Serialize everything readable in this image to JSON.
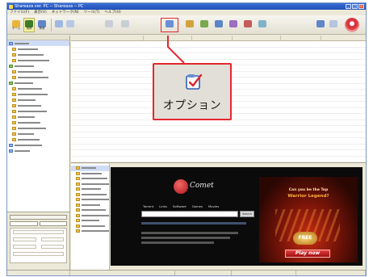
{
  "window": {
    "title": "Shareaza ver. PC -- Shareaza -- PC",
    "colors": {
      "accent": "#e52730",
      "titlebar": "#2a5fcc",
      "ad_background": "#0b0b0b"
    }
  },
  "menu": [
    "ファイル(F)",
    "表示(V)",
    "ネットワーク(N)",
    "ツール(T)",
    "ヘルプ(H)"
  ],
  "toolbar": {
    "buttons": [
      {
        "label": "ホーム",
        "icon": "home-icon"
      },
      {
        "label": "接続",
        "icon": "connect-icon"
      },
      {
        "label": "検索",
        "icon": "search-icon"
      },
      {
        "label": "",
        "icon": "nav-icon"
      },
      {
        "label": "",
        "icon": "nav-icon"
      },
      {
        "label": "",
        "icon": "nav-icon"
      },
      {
        "label": "",
        "icon": "options-icon"
      },
      {
        "label": "",
        "icon": "media-icon"
      },
      {
        "label": "",
        "icon": "media-icon"
      },
      {
        "label": "",
        "icon": "media-icon"
      },
      {
        "label": "",
        "icon": "media-icon"
      },
      {
        "label": "",
        "icon": "media-icon"
      }
    ]
  },
  "callout": {
    "label": "オプション",
    "icon": "options-checkmark-icon"
  },
  "sidebar": {
    "header": "",
    "items": [
      {
        "label": "",
        "kind": "blue"
      },
      {
        "label": "",
        "kind": "folder"
      },
      {
        "label": "",
        "kind": "folder"
      },
      {
        "label": "",
        "kind": "folder"
      },
      {
        "label": "",
        "kind": "green"
      },
      {
        "label": "",
        "kind": "folder"
      },
      {
        "label": "",
        "kind": "folder"
      },
      {
        "label": "",
        "kind": "green"
      },
      {
        "label": "",
        "kind": "folder"
      },
      {
        "label": "",
        "kind": "folder"
      },
      {
        "label": "",
        "kind": "folder"
      },
      {
        "label": "",
        "kind": "folder"
      },
      {
        "label": "",
        "kind": "folder"
      },
      {
        "label": "",
        "kind": "folder"
      },
      {
        "label": "",
        "kind": "folder"
      },
      {
        "label": "",
        "kind": "folder"
      },
      {
        "label": "",
        "kind": "folder"
      },
      {
        "label": "",
        "kind": "folder"
      },
      {
        "label": "",
        "kind": "blue"
      },
      {
        "label": "",
        "kind": "blue"
      }
    ]
  },
  "left_panel": {
    "title": "",
    "tabs": [
      "",
      ""
    ]
  },
  "preview_tree": [
    {
      "label": "",
      "kind": "folder"
    },
    {
      "label": "",
      "kind": "folder"
    },
    {
      "label": "",
      "kind": "folder"
    },
    {
      "label": "",
      "kind": "folder"
    },
    {
      "label": "",
      "kind": "folder"
    },
    {
      "label": "",
      "kind": "folder"
    },
    {
      "label": "",
      "kind": "folder"
    },
    {
      "label": "",
      "kind": "folder"
    },
    {
      "label": "",
      "kind": "folder"
    },
    {
      "label": "",
      "kind": "folder"
    },
    {
      "label": "",
      "kind": "folder"
    },
    {
      "label": "",
      "kind": "folder"
    },
    {
      "label": "",
      "kind": "folder"
    }
  ],
  "ad": {
    "logo_text": "Comet",
    "tabs": [
      "Torrent",
      "Links",
      "Software",
      "Games",
      "Movies"
    ],
    "search_button": "Search",
    "banner_line1": "Can you be the Top",
    "banner_line2": "Warrior Legend?",
    "banner_badge": "FREE",
    "banner_button": "Play now"
  }
}
